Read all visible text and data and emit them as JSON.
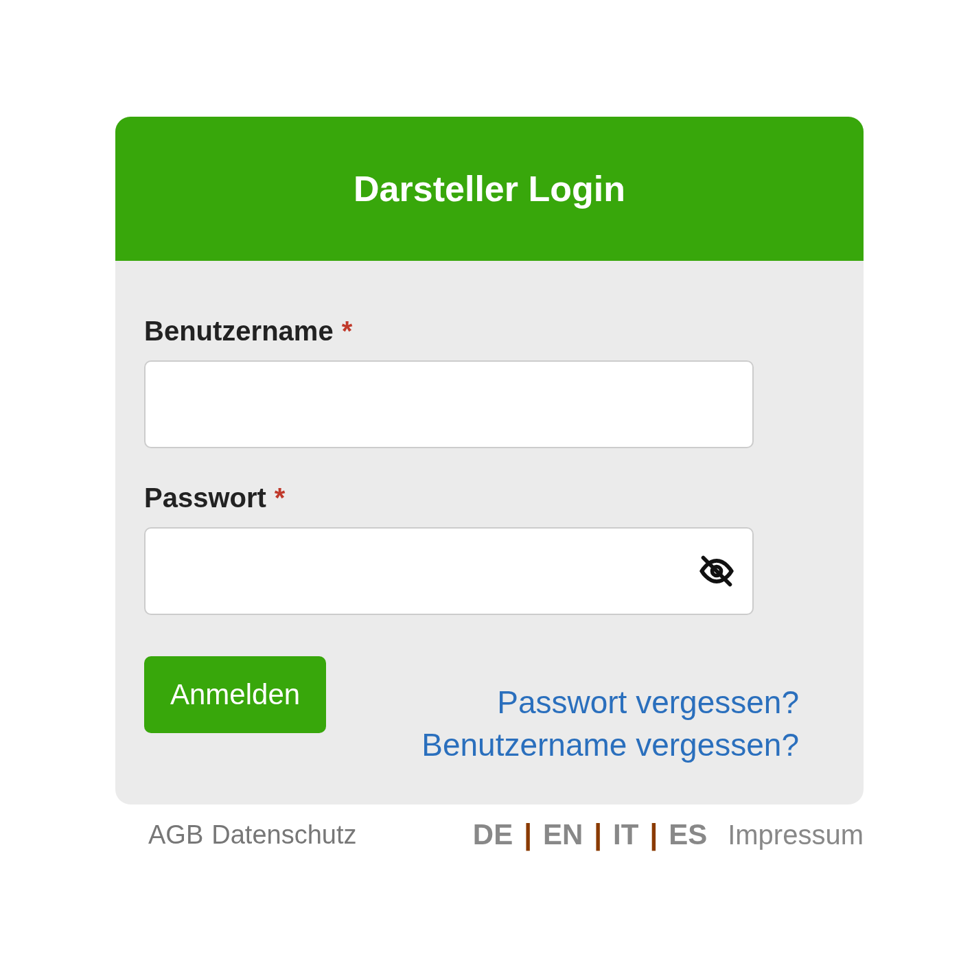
{
  "card": {
    "title": "Darsteller Login"
  },
  "fields": [
    {
      "label": "Benutzername",
      "required_mark": "*",
      "kind": "text"
    },
    {
      "label": "Passwort",
      "required_mark": "*",
      "kind": "password"
    }
  ],
  "submit_button": "Anmelden",
  "help_links": [
    "Passwort vergessen?",
    "Benutzername vergessen?"
  ],
  "footer": {
    "links": [
      "AGB",
      "Datenschutz"
    ],
    "languages": [
      "DE",
      "EN",
      "IT",
      "ES"
    ],
    "separator": "|",
    "imprint": "Impressum"
  }
}
